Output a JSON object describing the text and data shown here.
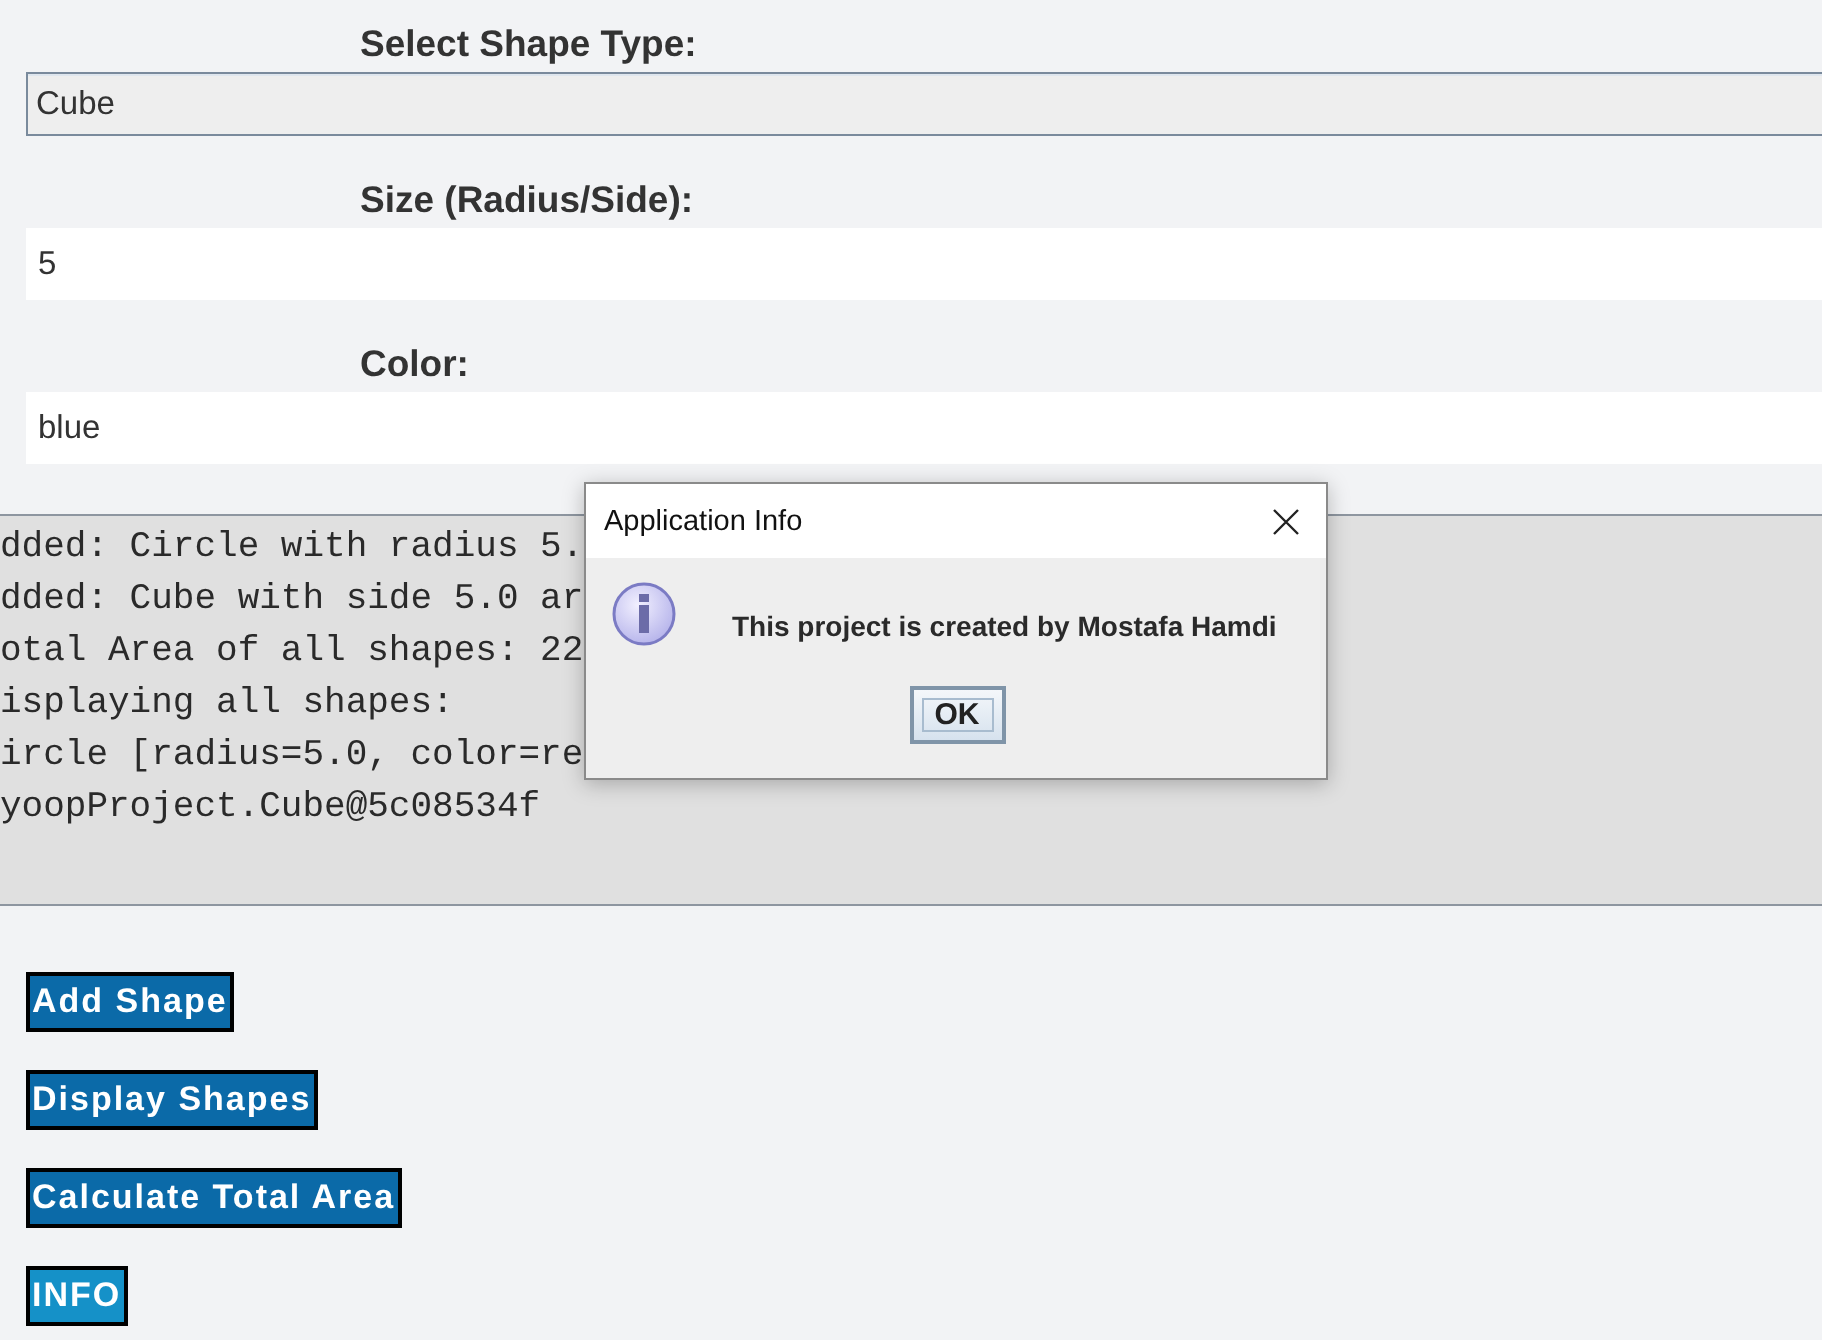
{
  "form": {
    "fields": [
      {
        "kind": "dropdown",
        "label": "Select Shape Type:",
        "value": "Cube"
      },
      {
        "kind": "text",
        "label": "Size (Radius/Side):",
        "value": "5"
      },
      {
        "kind": "text",
        "label": "Color:",
        "value": "blue"
      }
    ]
  },
  "console": {
    "lines": [
      "dded: Circle with radius 5.",
      "dded: Cube with side 5.0 ar",
      "otal Area of all shapes: 22",
      "isplaying all shapes:",
      "ircle [radius=5.0, color=re",
      "yoopProject.Cube@5c08534f"
    ]
  },
  "buttons": [
    {
      "label": "Add Shape",
      "focused": false
    },
    {
      "label": "Display Shapes",
      "focused": false
    },
    {
      "label": "Calculate Total Area",
      "focused": false
    },
    {
      "label": "INFO",
      "focused": true
    }
  ],
  "dialog": {
    "title": "Application Info",
    "message": "This project is created by Mostafa Hamdi",
    "button": "OK"
  }
}
